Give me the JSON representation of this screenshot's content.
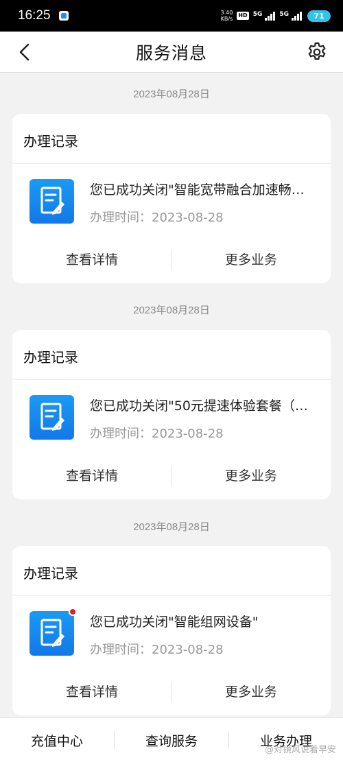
{
  "status_bar": {
    "time": "16:25",
    "speed_value": "3.40",
    "speed_unit": "KB/s",
    "hd": "HD",
    "net1": "5G",
    "net2": "5G",
    "battery": "71"
  },
  "header": {
    "title": "服务消息"
  },
  "cards": [
    {
      "date": "2023年08月28日",
      "title": "办理记录",
      "message": "您已成功关闭\"智能宽带融合加速畅…",
      "time_label": "办理时间：",
      "time_value": "2023-08-28",
      "detail_label": "查看详情",
      "more_label": "更多业务"
    },
    {
      "date": "2023年08月28日",
      "title": "办理记录",
      "message": "您已成功关闭\"50元提速体验套餐（…",
      "time_label": "办理时间：",
      "time_value": "2023-08-28",
      "detail_label": "查看详情",
      "more_label": "更多业务"
    },
    {
      "date": "2023年08月28日",
      "title": "办理记录",
      "message": "您已成功关闭\"智能组网设备\"",
      "time_label": "办理时间：",
      "time_value": "2023-08-28",
      "detail_label": "查看详情",
      "more_label": "更多业务"
    }
  ],
  "bottom_tabs": [
    {
      "label": "充值中心"
    },
    {
      "label": "查询服务"
    },
    {
      "label": "业务办理"
    }
  ],
  "watermark": "@对镜风说着早安",
  "colors": {
    "accent_blue": "#1b8cf2",
    "unread_red": "#e81b1b",
    "battery": "#34c3e8"
  }
}
